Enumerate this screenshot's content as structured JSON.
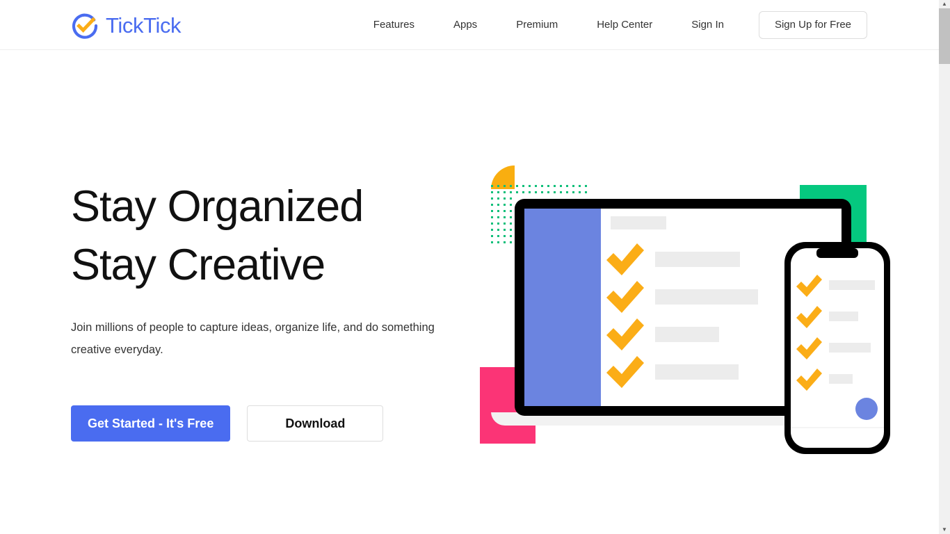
{
  "site": {
    "brand_name": "TickTick",
    "logo_icon": "ticktick-check-circle-icon",
    "brand_color": "#4a6cf0",
    "accent_color": "#fbad17"
  },
  "header": {
    "nav_items": [
      {
        "label": "Features",
        "name": "nav-features"
      },
      {
        "label": "Apps",
        "name": "nav-apps"
      },
      {
        "label": "Premium",
        "name": "nav-premium"
      },
      {
        "label": "Help Center",
        "name": "nav-help-center"
      },
      {
        "label": "Sign In",
        "name": "nav-sign-in"
      }
    ],
    "signup_label": "Sign Up for Free"
  },
  "hero": {
    "headline_line1": "Stay Organized",
    "headline_line2": "Stay Creative",
    "headline": "Stay Organized\nStay Creative",
    "subheadline": "Join millions of people to capture ideas, organize life, and do something creative everyday.",
    "primary_cta": "Get Started - It's Free",
    "secondary_cta": "Download"
  },
  "illustration": {
    "alt": "Laptop and phone showing a checklist of completed tasks",
    "colors": {
      "device_frame": "#000000",
      "sidebar": "#6b84e0",
      "checkmark": "#fbad17",
      "placeholder_bar": "#ececec",
      "shape_orange": "#f9ae10",
      "shape_green": "#05c87f",
      "shape_pink": "#fb3476",
      "dots_green": "#0fbf7a",
      "fab": "#6b84e0",
      "laptop_base": "#f2f2f2"
    },
    "laptop_tasks": 4,
    "phone_tasks": 4
  },
  "scrollbar": {
    "up_arrow_icon": "caret-up-icon",
    "down_arrow_icon": "caret-down-icon",
    "thumb_position": "top"
  }
}
